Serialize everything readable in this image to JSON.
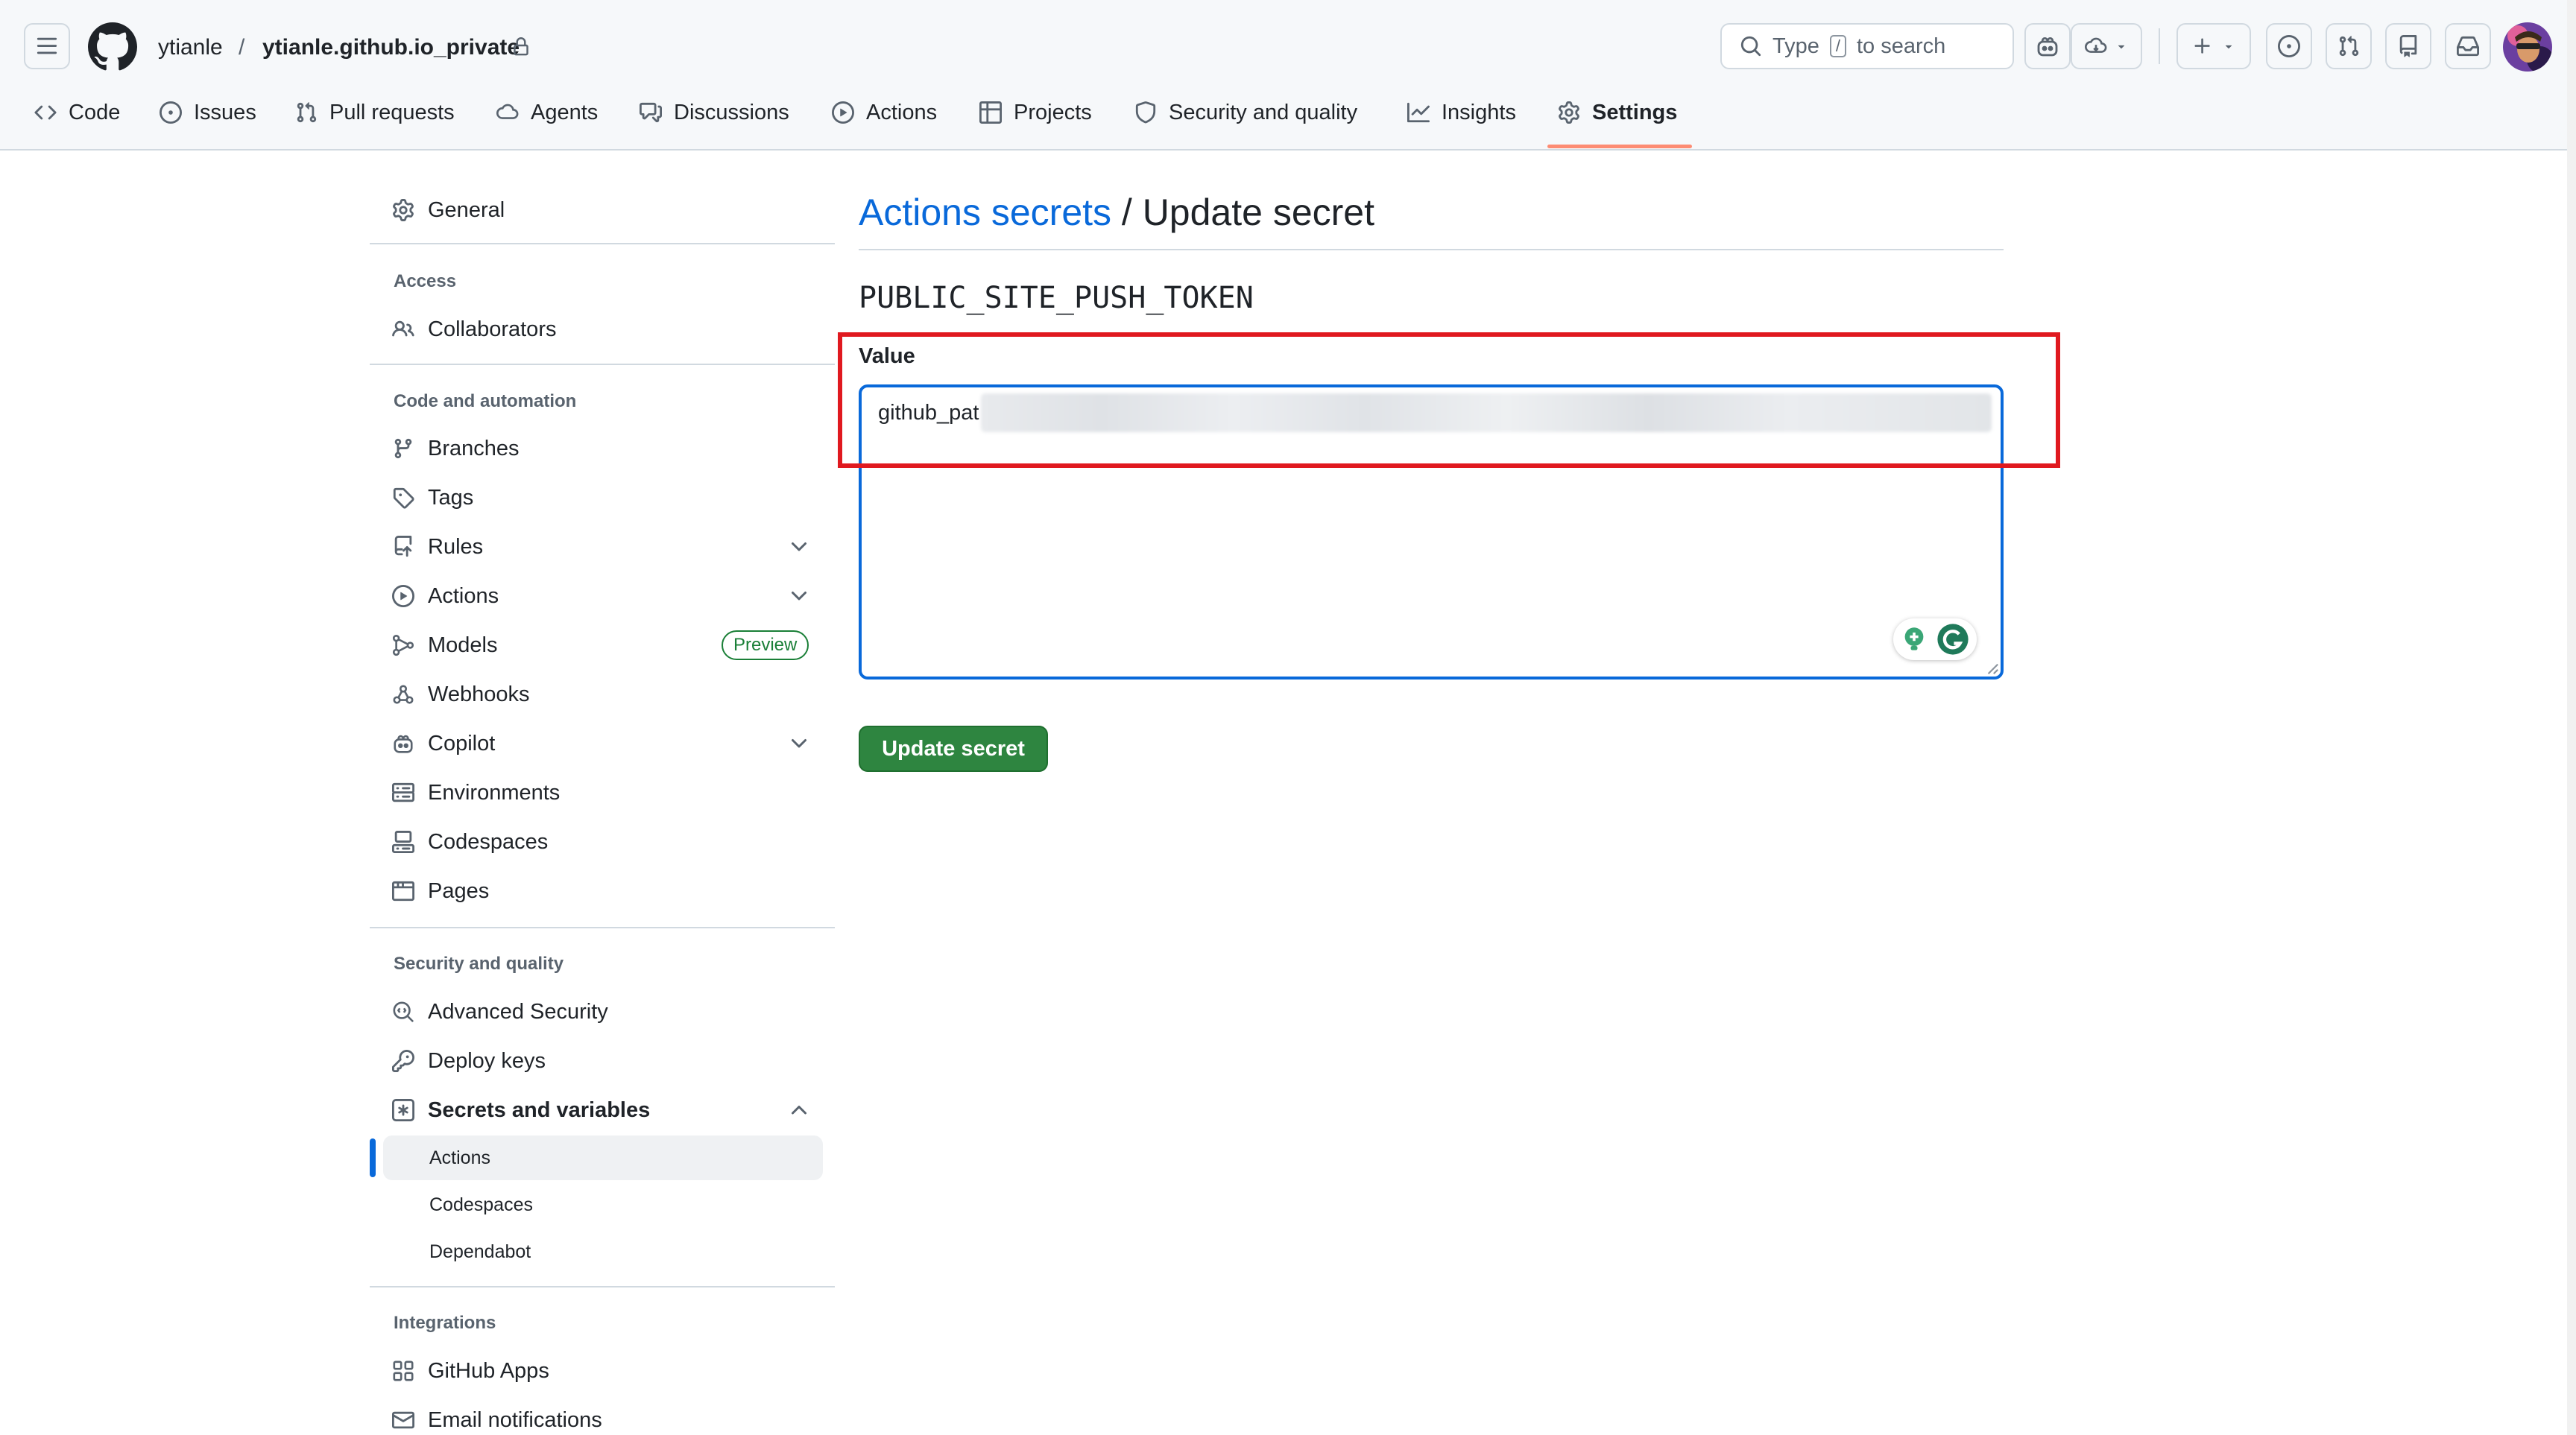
{
  "header": {
    "owner": "ytianle",
    "separator": "/",
    "repo": "ytianle.github.io_private",
    "search": {
      "prefix": "Type",
      "key": "/",
      "suffix": "to search"
    }
  },
  "repo_nav": {
    "tabs": [
      {
        "label": "Code",
        "icon": "code-icon"
      },
      {
        "label": "Issues",
        "icon": "issue-opened-icon"
      },
      {
        "label": "Pull requests",
        "icon": "git-pull-request-icon"
      },
      {
        "label": "Agents",
        "icon": "agent-icon"
      },
      {
        "label": "Discussions",
        "icon": "comment-discussion-icon"
      },
      {
        "label": "Actions",
        "icon": "play-icon"
      },
      {
        "label": "Projects",
        "icon": "table-icon"
      },
      {
        "label": "Security and quality",
        "icon": "shield-icon"
      },
      {
        "label": "Insights",
        "icon": "graph-icon"
      },
      {
        "label": "Settings",
        "icon": "gear-icon",
        "active": true
      }
    ]
  },
  "sidebar": {
    "general": "General",
    "sections": [
      {
        "heading": "Access",
        "items": [
          "Collaborators"
        ]
      },
      {
        "heading": "Code and automation",
        "items": [
          "Branches",
          "Tags",
          "Rules",
          "Actions",
          "Models",
          "Webhooks",
          "Copilot",
          "Environments",
          "Codespaces",
          "Pages"
        ]
      },
      {
        "heading": "Security and quality",
        "items": [
          "Advanced Security",
          "Deploy keys",
          "Secrets and variables"
        ]
      },
      {
        "heading": "Integrations",
        "items": [
          "GitHub Apps",
          "Email notifications"
        ]
      }
    ],
    "models_badge": "Preview",
    "secrets_subitems": [
      "Actions",
      "Codespaces",
      "Dependabot"
    ]
  },
  "main": {
    "breadcrumb_link": "Actions secrets",
    "breadcrumb_rest": " / Update secret",
    "secret_name": "PUBLIC_SITE_PUSH_TOKEN",
    "value_label": "Value",
    "value_visible": "github_pat",
    "submit_label": "Update secret"
  },
  "colors": {
    "accent_link": "#0969da",
    "primary_button": "#2e8540",
    "highlight_box": "#e0191f",
    "active_tab_underline": "#fd8c73"
  }
}
